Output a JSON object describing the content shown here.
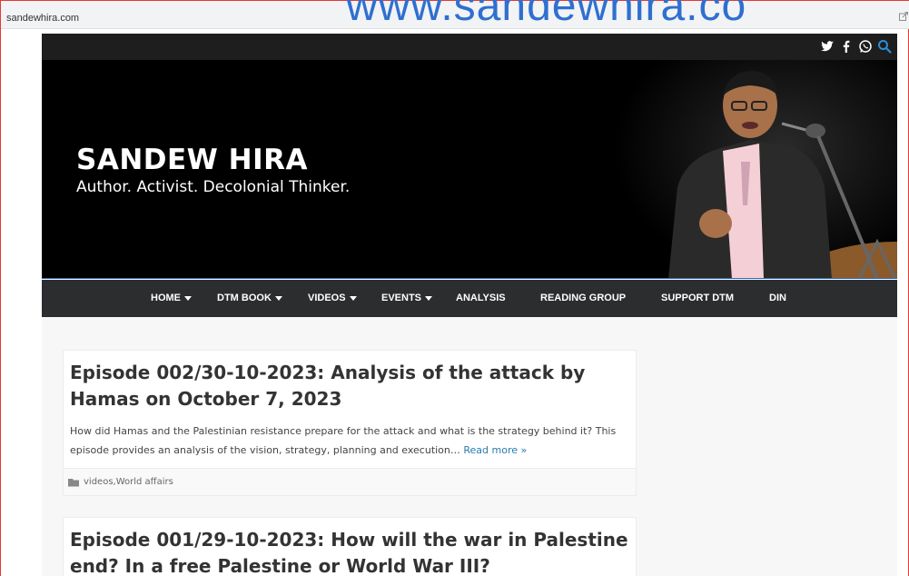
{
  "browser": {
    "url": "sandewhira.com",
    "watermark": "www.sandewhira.co"
  },
  "header": {
    "social_icons": [
      "twitter-icon",
      "facebook-icon",
      "whatsapp-icon",
      "search-icon"
    ],
    "title": "SANDEW HIRA",
    "tagline": "Author. Activist. Decolonial Thinker."
  },
  "nav": {
    "items": [
      {
        "label": "HOME",
        "dropdown": true
      },
      {
        "label": "DTM BOOK",
        "dropdown": true
      },
      {
        "label": "VIDEOS",
        "dropdown": true
      },
      {
        "label": "EVENTS",
        "dropdown": true
      },
      {
        "label": "ANALYSIS",
        "dropdown": false
      },
      {
        "label": "READING GROUP",
        "dropdown": false
      },
      {
        "label": "SUPPORT DTM",
        "dropdown": false
      },
      {
        "label": "DIN",
        "dropdown": false
      }
    ]
  },
  "posts": [
    {
      "title": "Episode 002/30-10-2023: Analysis of the attack by Hamas on October 7, 2023",
      "excerpt": "How did Hamas and the Palestinian resistance prepare for the attack and what is the strategy behind it? This episode provides an analysis of the vision, strategy, planning and execution…",
      "read_more": "Read more »",
      "categories": [
        "videos",
        "World affairs"
      ],
      "category_sep": ", "
    },
    {
      "title": "Episode 001/29-10-2023: How will the war in Palestine end? In a free Palestine or World War III?"
    }
  ],
  "colors": {
    "topbar": "#1e1e1e",
    "nav": "#2b2d2f",
    "link": "#2a7ab0",
    "search_icon": "#2a8fd6"
  }
}
